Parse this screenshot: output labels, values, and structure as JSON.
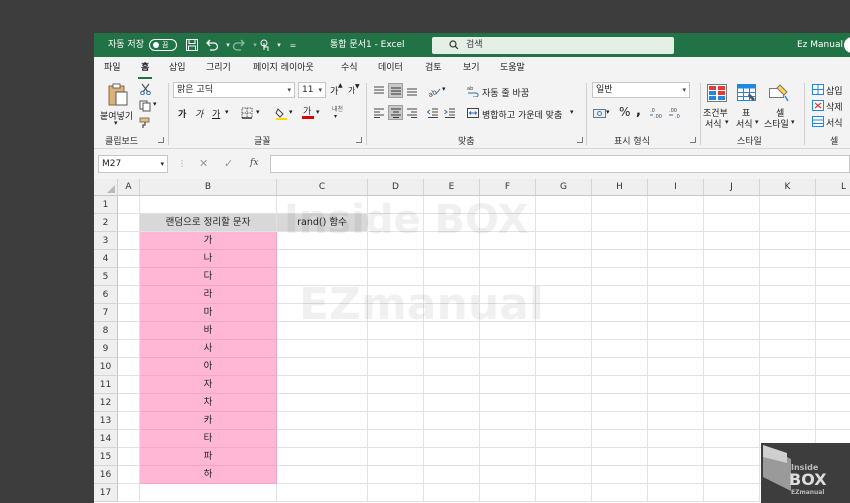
{
  "titlebar": {
    "autosave_label": "자동 저장",
    "autosave_state": "끔",
    "doc_title": "통합 문서1 - Excel",
    "search_placeholder": "검색",
    "user_name": "Ez Manual",
    "user_initial": "E"
  },
  "tabs": [
    "파일",
    "홈",
    "삽입",
    "그리기",
    "페이지 레이아웃",
    "수식",
    "데이터",
    "검토",
    "보기",
    "도움말"
  ],
  "active_tab": "홈",
  "ribbon": {
    "clipboard": {
      "paste_label": "붙여넣기",
      "group_label": "클립보드"
    },
    "font": {
      "font_name": "맑은 고딕",
      "font_size": "11",
      "bold": "가",
      "italic": "가",
      "underline": "가",
      "grow": "가",
      "shrink": "가",
      "phonetic": "내천",
      "group_label": "글꼴"
    },
    "alignment": {
      "wrap_text": "자동 줄 바꿈",
      "merge_center": "병합하고 가운데 맞춤",
      "group_label": "맞춤"
    },
    "number": {
      "format": "일반",
      "group_label": "표시 형식"
    },
    "styles": {
      "conditional_line1": "조건부",
      "conditional_line2": "서식",
      "table_line1": "표",
      "table_line2": "서식",
      "cell_line1": "셀",
      "cell_line2": "스타일",
      "group_label": "스타일"
    },
    "cells": {
      "insert": "삽입",
      "delete": "삭제",
      "format": "서식",
      "group_label": "셀"
    }
  },
  "formula_bar": {
    "name_box": "M27",
    "fx": "fx",
    "formula": ""
  },
  "columns": [
    "A",
    "B",
    "C",
    "D",
    "E",
    "F",
    "G",
    "H",
    "I",
    "J",
    "K",
    "L"
  ],
  "rows": [
    "1",
    "2",
    "3",
    "4",
    "5",
    "6",
    "7",
    "8",
    "9",
    "10",
    "11",
    "12",
    "13",
    "14",
    "15",
    "16",
    "17"
  ],
  "sheet": {
    "b2": "랜덤으로 정리할 문자",
    "c2": "rand() 함수",
    "b_values": [
      "가",
      "나",
      "다",
      "라",
      "마",
      "바",
      "사",
      "아",
      "자",
      "차",
      "카",
      "타",
      "파",
      "하"
    ]
  },
  "watermark": {
    "line1": "Inside BOX",
    "line2": "EZmanual"
  },
  "logo": {
    "line1": "Inside",
    "line2": "BOX",
    "line3": "EZmanual"
  },
  "colors": {
    "excel_green": "#217346",
    "pink_fill": "#ffb7d5",
    "header_fill": "#d8d8d8"
  }
}
